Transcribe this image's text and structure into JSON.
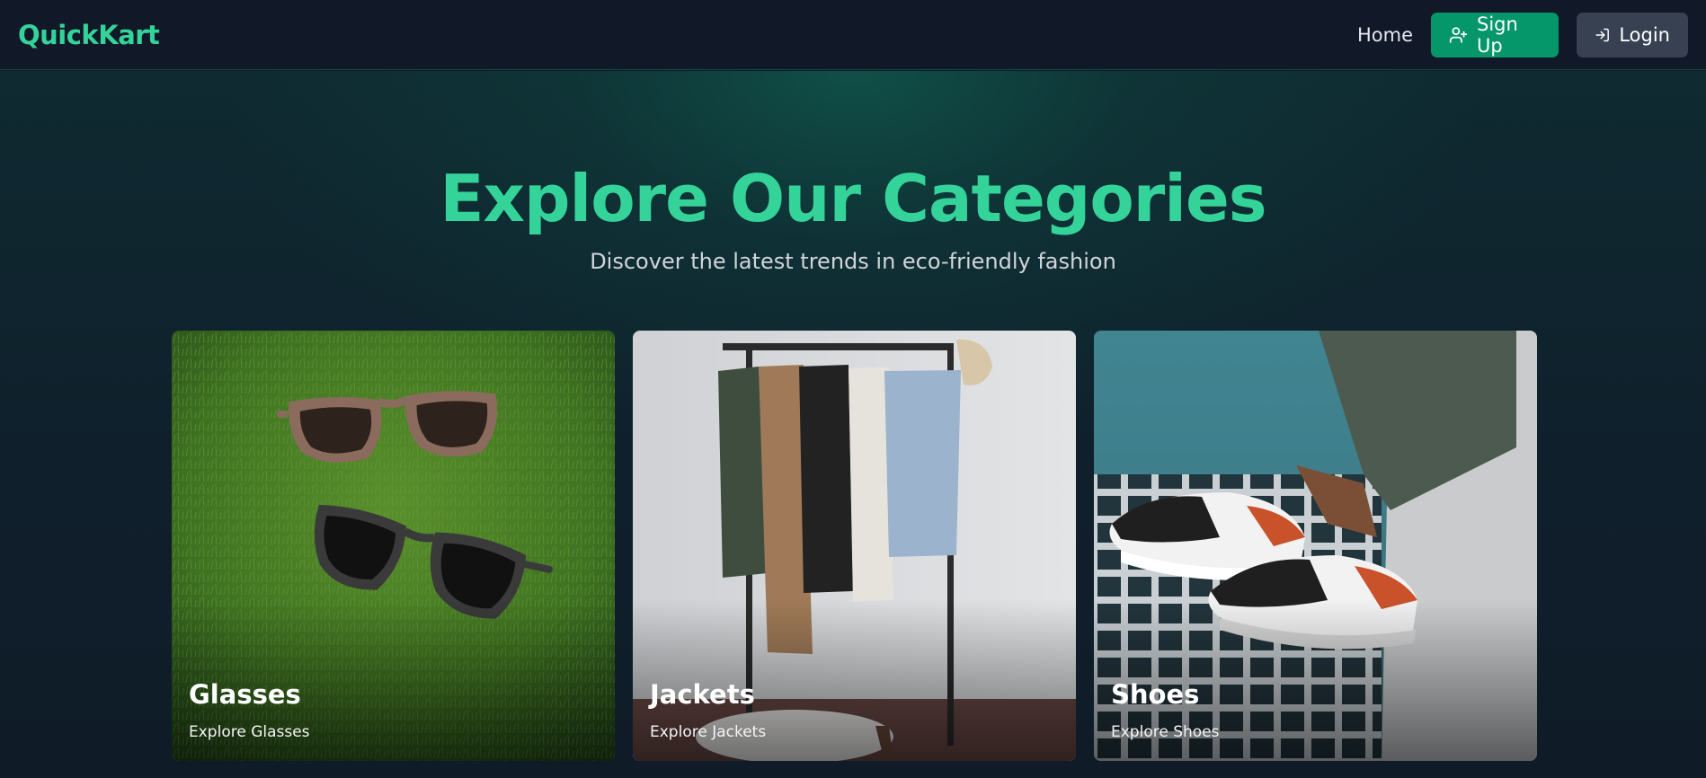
{
  "navbar": {
    "logo": "QuickKart",
    "home_label": "Home",
    "signup_label": "Sign Up",
    "login_label": "Login"
  },
  "hero": {
    "title": "Explore Our Categories",
    "subtitle": "Discover the latest trends in eco-friendly fashion"
  },
  "categories": [
    {
      "title": "Glasses",
      "link": "Explore Glasses",
      "image": "sunglasses-on-grass"
    },
    {
      "title": "Jackets",
      "link": "Explore Jackets",
      "image": "jackets-on-rack"
    },
    {
      "title": "Shoes",
      "link": "Explore Shoes",
      "image": "sneakers-city"
    }
  ],
  "colors": {
    "accent": "#34d399",
    "signup_bg": "#059669",
    "login_bg": "#374151",
    "background": "#111827"
  },
  "icons": {
    "signup": "user-plus-icon",
    "login": "log-in-icon"
  }
}
